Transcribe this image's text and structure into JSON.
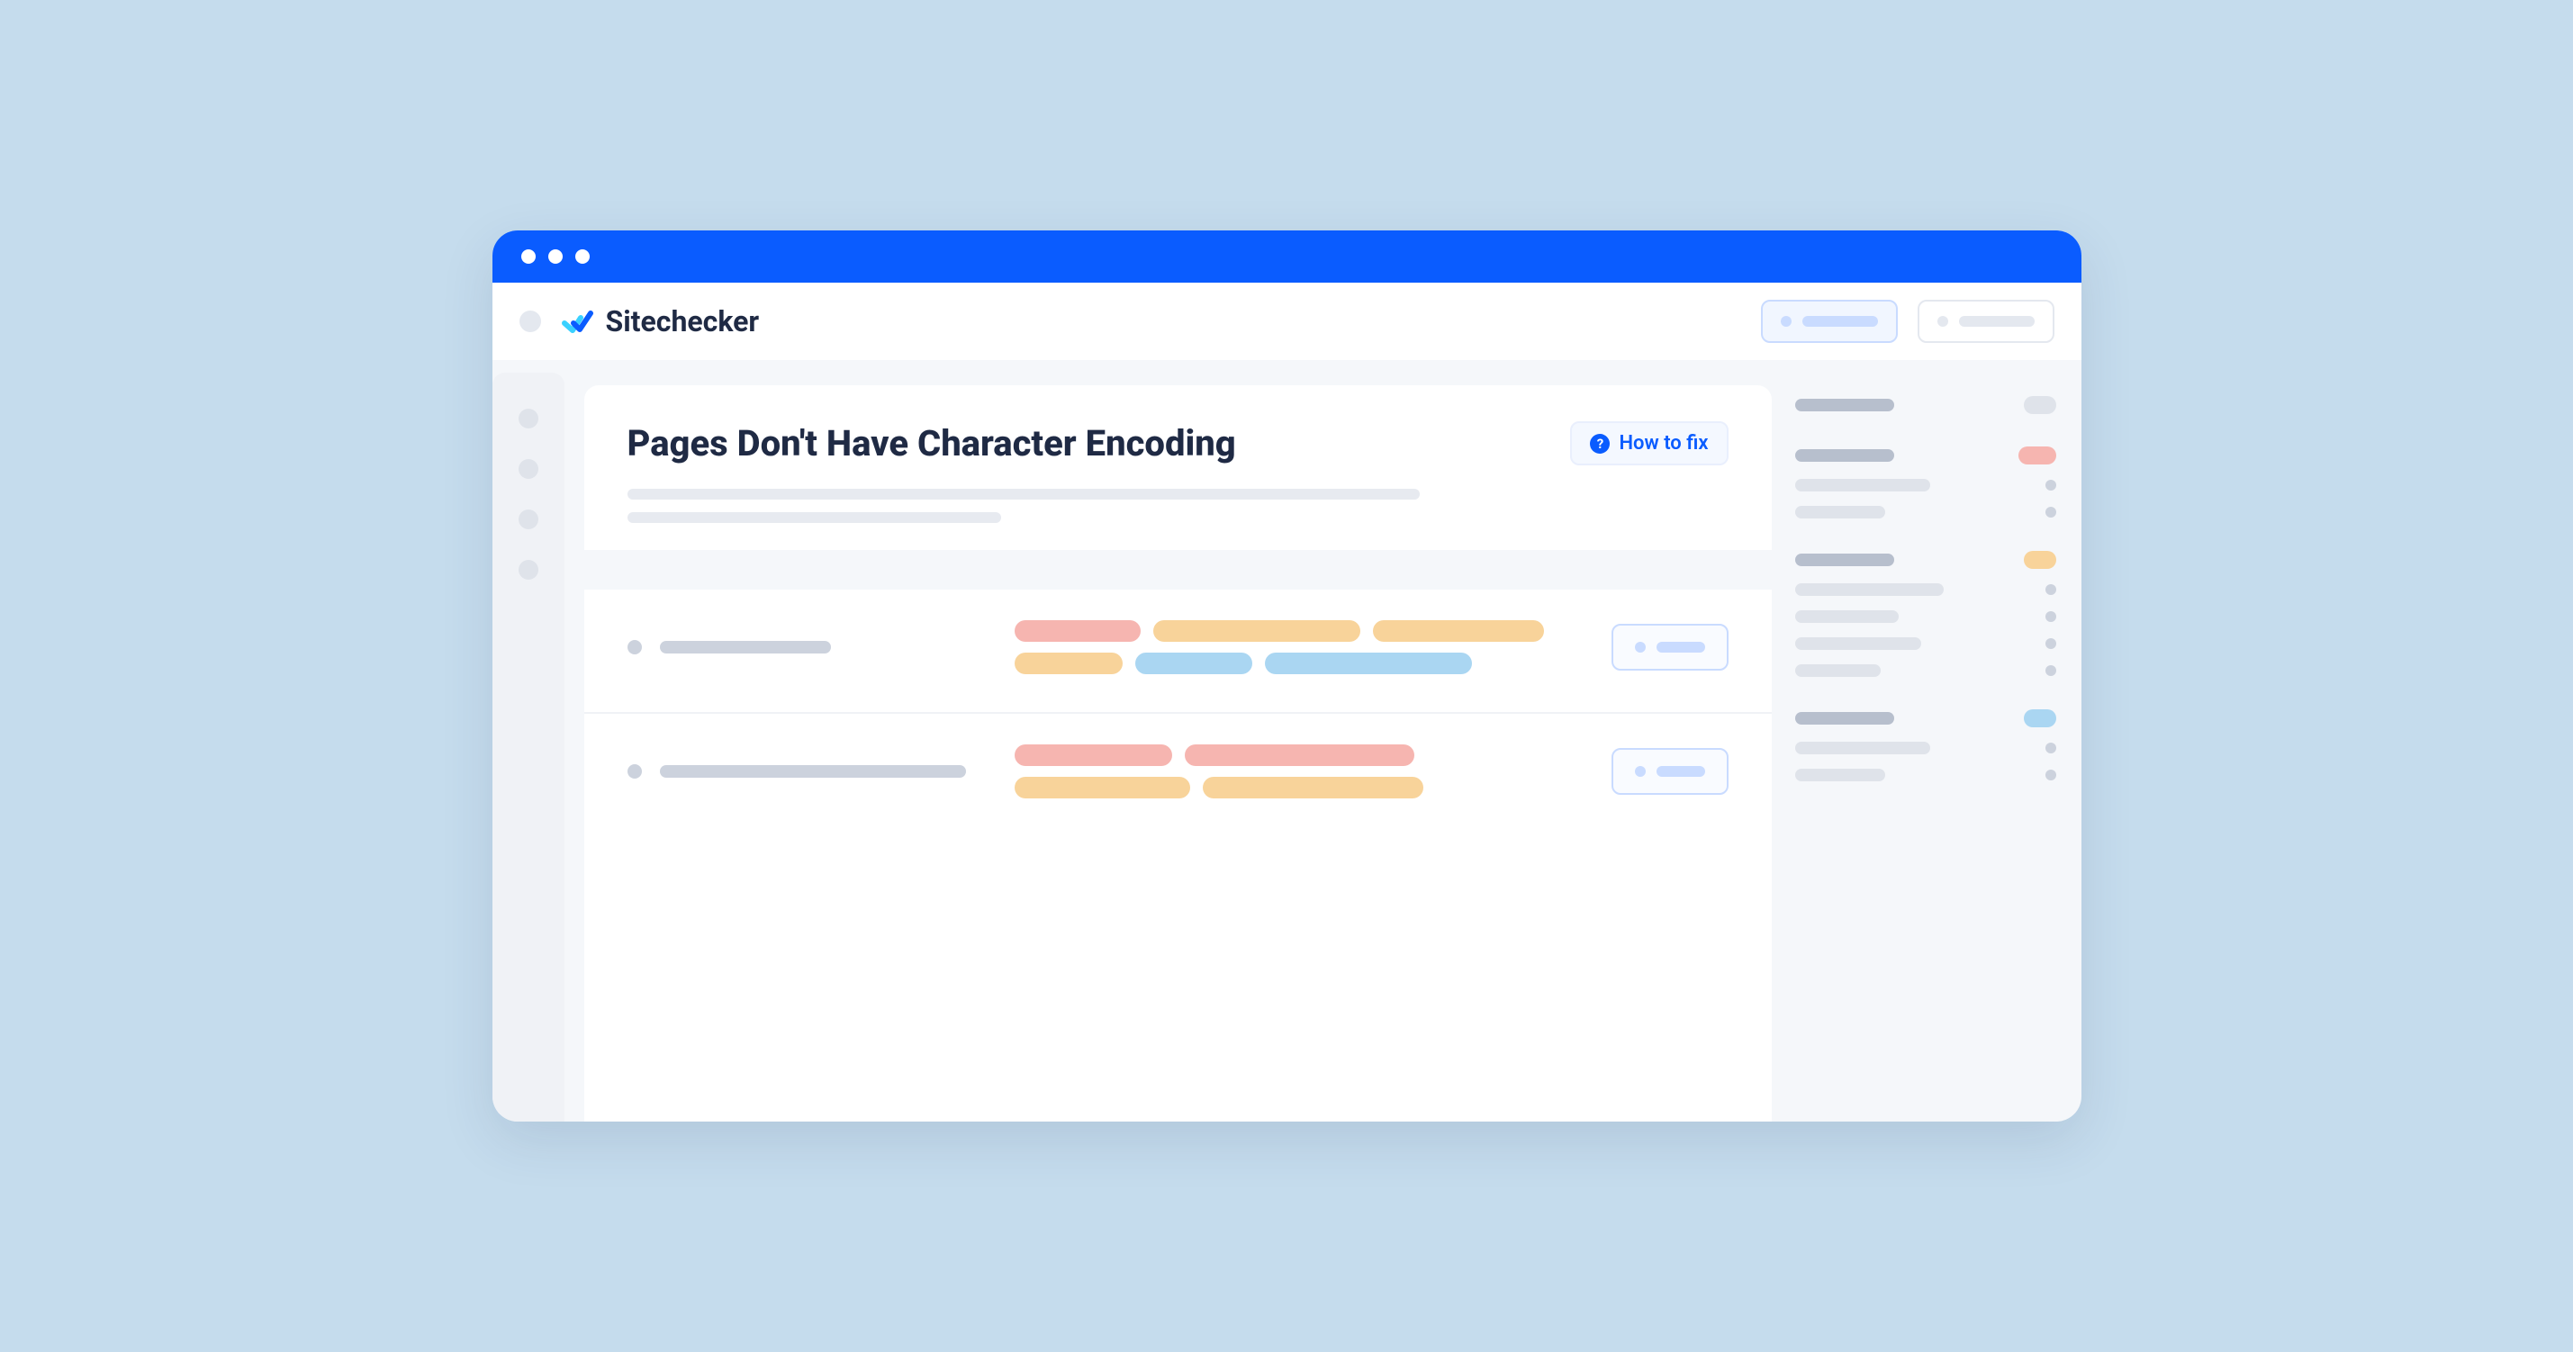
{
  "brand": {
    "name": "Sitechecker"
  },
  "page": {
    "title": "Pages Don't Have Character Encoding",
    "how_to_fix_label": "How to fix"
  },
  "colors": {
    "background": "#c5dced",
    "accent": "#0a5cff",
    "salmon": "#f6b5b0",
    "peach": "#f8d39a",
    "sky": "#aad6f2"
  }
}
